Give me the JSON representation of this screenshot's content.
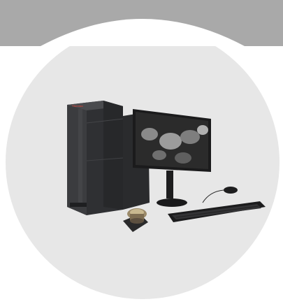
{
  "colors": {
    "band": "#a9a9a9",
    "circle": "#e7e7e7",
    "background": "#ffffff",
    "instrument_dark": "#2d2e30",
    "instrument_mid": "#3a3b3e",
    "screen": "#262626",
    "brand_accent": "#d0443a"
  },
  "branding": {
    "logo_text": "Thermo"
  },
  "scene": {
    "instrument": "benchtop-sem-icon",
    "monitor": "monitor-icon",
    "keyboard": "keyboard-icon",
    "mouse": "mouse-icon",
    "sample_holder": "sample-holder-icon"
  }
}
